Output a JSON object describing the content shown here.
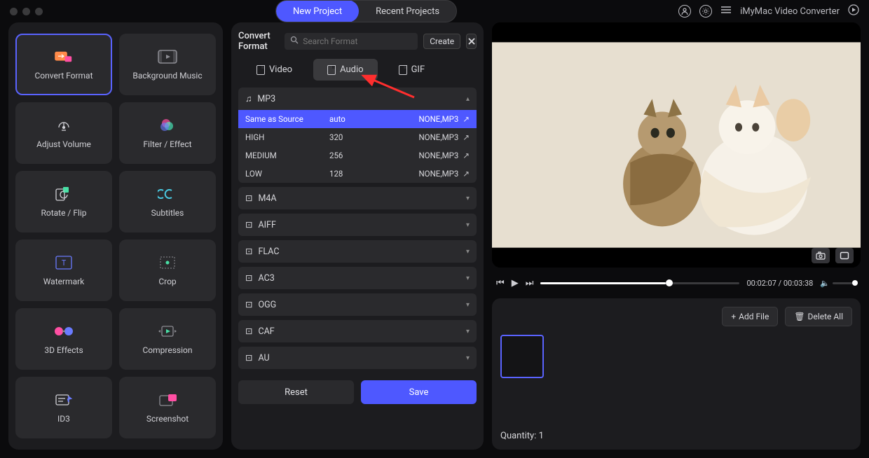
{
  "header": {
    "tabs": [
      "New Project",
      "Recent Projects"
    ],
    "active_tab_index": 0,
    "app_title": "iMyMac Video Converter"
  },
  "sidebar": {
    "tools": [
      {
        "id": "convert-format",
        "label": "Convert Format",
        "active": true
      },
      {
        "id": "background-music",
        "label": "Background Music"
      },
      {
        "id": "adjust-volume",
        "label": "Adjust Volume"
      },
      {
        "id": "filter-effect",
        "label": "Filter / Effect"
      },
      {
        "id": "rotate-flip",
        "label": "Rotate / Flip"
      },
      {
        "id": "subtitles",
        "label": "Subtitles"
      },
      {
        "id": "watermark",
        "label": "Watermark"
      },
      {
        "id": "crop",
        "label": "Crop"
      },
      {
        "id": "3d-effects",
        "label": "3D Effects"
      },
      {
        "id": "compression",
        "label": "Compression"
      },
      {
        "id": "id3",
        "label": "ID3"
      },
      {
        "id": "screenshot",
        "label": "Screenshot"
      }
    ]
  },
  "center": {
    "title": "Convert Format",
    "search_placeholder": "Search Format",
    "create_label": "Create",
    "format_tabs": [
      "Video",
      "Audio",
      "GIF"
    ],
    "active_fmt_tab_index": 1,
    "expanded_group": "MP3",
    "mp3_presets": [
      {
        "quality": "Same as Source",
        "bitrate": "auto",
        "codec": "NONE,MP3",
        "selected": true
      },
      {
        "quality": "HIGH",
        "bitrate": "320",
        "codec": "NONE,MP3"
      },
      {
        "quality": "MEDIUM",
        "bitrate": "256",
        "codec": "NONE,MP3"
      },
      {
        "quality": "LOW",
        "bitrate": "128",
        "codec": "NONE,MP3"
      }
    ],
    "other_groups": [
      "M4A",
      "AIFF",
      "FLAC",
      "AC3",
      "OGG",
      "CAF",
      "AU"
    ],
    "reset_label": "Reset",
    "save_label": "Save"
  },
  "preview": {
    "current_time": "00:02:07",
    "total_time": "00:03:38",
    "progress_pct": 63
  },
  "project": {
    "add_file_label": "Add File",
    "delete_all_label": "Delete All",
    "quantity_label": "Quantity:",
    "quantity": 1
  }
}
